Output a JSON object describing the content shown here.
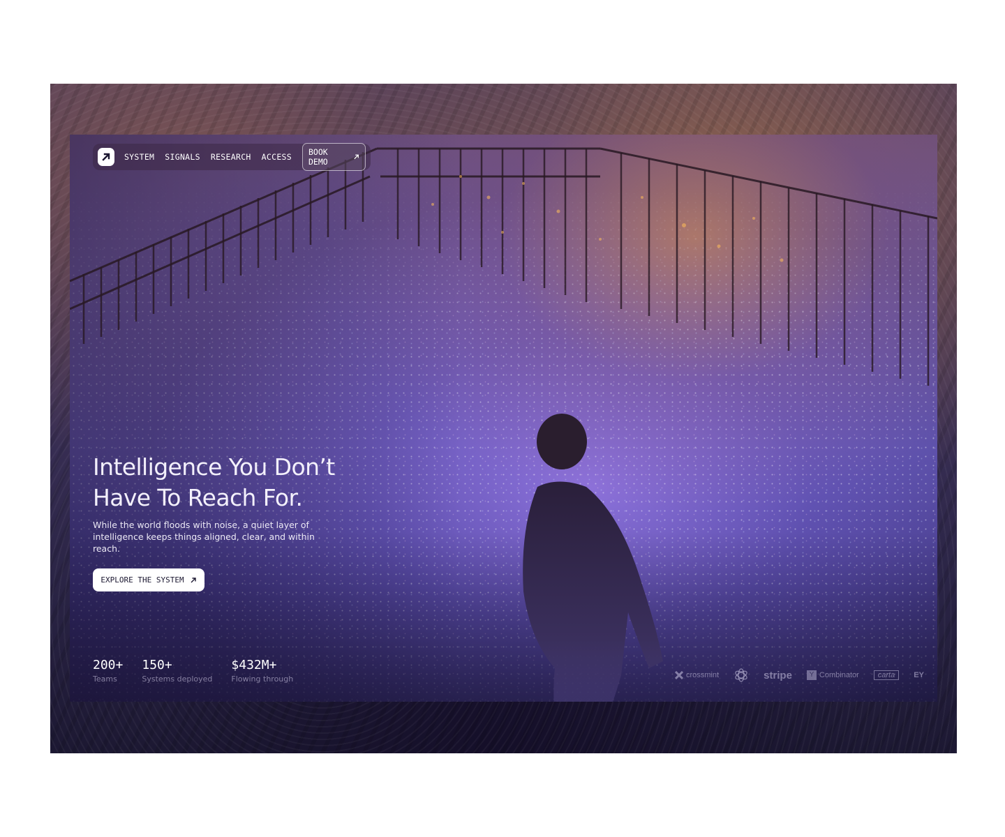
{
  "nav": {
    "logo_icon": "arrow-up-right-icon",
    "links": [
      "SYSTEM",
      "SIGNALS",
      "RESEARCH",
      "ACCESS"
    ],
    "book_demo": "BOOK DEMO"
  },
  "hero": {
    "headline_line1": "Intelligence You Don’t",
    "headline_line2": "Have To Reach For.",
    "subtitle": "While the world floods with noise, a quiet layer of intelligence keeps things aligned, clear, and within reach.",
    "cta": "EXPLORE THE SYSTEM"
  },
  "stats": [
    {
      "value": "200+",
      "label": "Teams"
    },
    {
      "value": "150+",
      "label": "Systems deployed"
    },
    {
      "value": "$432M+",
      "label": "Flowing through"
    }
  ],
  "logos": {
    "crossmint": "crossmint",
    "openai_icon": "openai-knot-icon",
    "stripe": "stripe",
    "ycombinator_mark": "Y",
    "ycombinator": "Combinator",
    "carta": "carta",
    "ey": "EY"
  },
  "colors": {
    "background": "#ffffff",
    "hero_violet": "#5e55a8",
    "text": "#ffffff",
    "cta_bg": "#ffffff"
  }
}
